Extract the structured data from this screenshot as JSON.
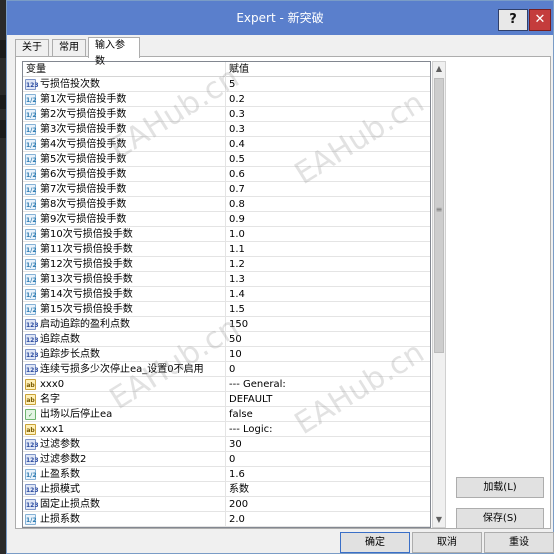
{
  "window": {
    "title": "Expert - 新突破",
    "help_label": "?",
    "close_label": "✕"
  },
  "tabs": [
    {
      "label": "关于"
    },
    {
      "label": "常用"
    },
    {
      "label": "输入参数"
    }
  ],
  "grid": {
    "columns": [
      "变量",
      "赋值"
    ],
    "rows": [
      {
        "type": "int",
        "type_label": "123",
        "name": "亏损倍投次数",
        "value": "5"
      },
      {
        "type": "dbl",
        "type_label": "1/2",
        "name": "第1次亏损倍投手数",
        "value": "0.2"
      },
      {
        "type": "dbl",
        "type_label": "1/2",
        "name": "第2次亏损倍投手数",
        "value": "0.3"
      },
      {
        "type": "dbl",
        "type_label": "1/2",
        "name": "第3次亏损倍投手数",
        "value": "0.3"
      },
      {
        "type": "dbl",
        "type_label": "1/2",
        "name": "第4次亏损倍投手数",
        "value": "0.4"
      },
      {
        "type": "dbl",
        "type_label": "1/2",
        "name": "第5次亏损倍投手数",
        "value": "0.5"
      },
      {
        "type": "dbl",
        "type_label": "1/2",
        "name": "第6次亏损倍投手数",
        "value": "0.6"
      },
      {
        "type": "dbl",
        "type_label": "1/2",
        "name": "第7次亏损倍投手数",
        "value": "0.7"
      },
      {
        "type": "dbl",
        "type_label": "1/2",
        "name": "第8次亏损倍投手数",
        "value": "0.8"
      },
      {
        "type": "dbl",
        "type_label": "1/2",
        "name": "第9次亏损倍投手数",
        "value": "0.9"
      },
      {
        "type": "dbl",
        "type_label": "1/2",
        "name": "第10次亏损倍投手数",
        "value": "1.0"
      },
      {
        "type": "dbl",
        "type_label": "1/2",
        "name": "第11次亏损倍投手数",
        "value": "1.1"
      },
      {
        "type": "dbl",
        "type_label": "1/2",
        "name": "第12次亏损倍投手数",
        "value": "1.2"
      },
      {
        "type": "dbl",
        "type_label": "1/2",
        "name": "第13次亏损倍投手数",
        "value": "1.3"
      },
      {
        "type": "dbl",
        "type_label": "1/2",
        "name": "第14次亏损倍投手数",
        "value": "1.4"
      },
      {
        "type": "dbl",
        "type_label": "1/2",
        "name": "第15次亏损倍投手数",
        "value": "1.5"
      },
      {
        "type": "int",
        "type_label": "123",
        "name": "启动追踪的盈利点数",
        "value": "150"
      },
      {
        "type": "int",
        "type_label": "123",
        "name": "追踪点数",
        "value": "50"
      },
      {
        "type": "int",
        "type_label": "123",
        "name": "追踪步长点数",
        "value": "10"
      },
      {
        "type": "int",
        "type_label": "123",
        "name": "连续亏损多少次停止ea_设置0不启用",
        "value": "0"
      },
      {
        "type": "str",
        "type_label": "ab",
        "name": "xxx0",
        "value": "--- General:"
      },
      {
        "type": "str",
        "type_label": "ab",
        "name": "名字",
        "value": "DEFAULT"
      },
      {
        "type": "bool",
        "type_label": "✓",
        "name": "出场以后停止ea",
        "value": "false"
      },
      {
        "type": "str",
        "type_label": "ab",
        "name": "xxx1",
        "value": "--- Logic:"
      },
      {
        "type": "int",
        "type_label": "123",
        "name": "过滤参数",
        "value": "30"
      },
      {
        "type": "int",
        "type_label": "123",
        "name": "过滤参数2",
        "value": "0"
      },
      {
        "type": "dbl",
        "type_label": "1/2",
        "name": "止盈系数",
        "value": "1.6"
      },
      {
        "type": "int",
        "type_label": "123",
        "name": "止损模式",
        "value": "系数"
      },
      {
        "type": "int",
        "type_label": "123",
        "name": "固定止损点数",
        "value": "200"
      },
      {
        "type": "dbl",
        "type_label": "1/2",
        "name": "止损系数",
        "value": "2.0"
      }
    ]
  },
  "scrollbar": {
    "up_icon": "▲",
    "down_icon": "▼",
    "grip_icon": "≡"
  },
  "buttons": {
    "load": "加载(L)",
    "save": "保存(S)",
    "ok": "确定",
    "cancel": "取消",
    "reset": "重设"
  },
  "watermark": "EAHub.cn"
}
